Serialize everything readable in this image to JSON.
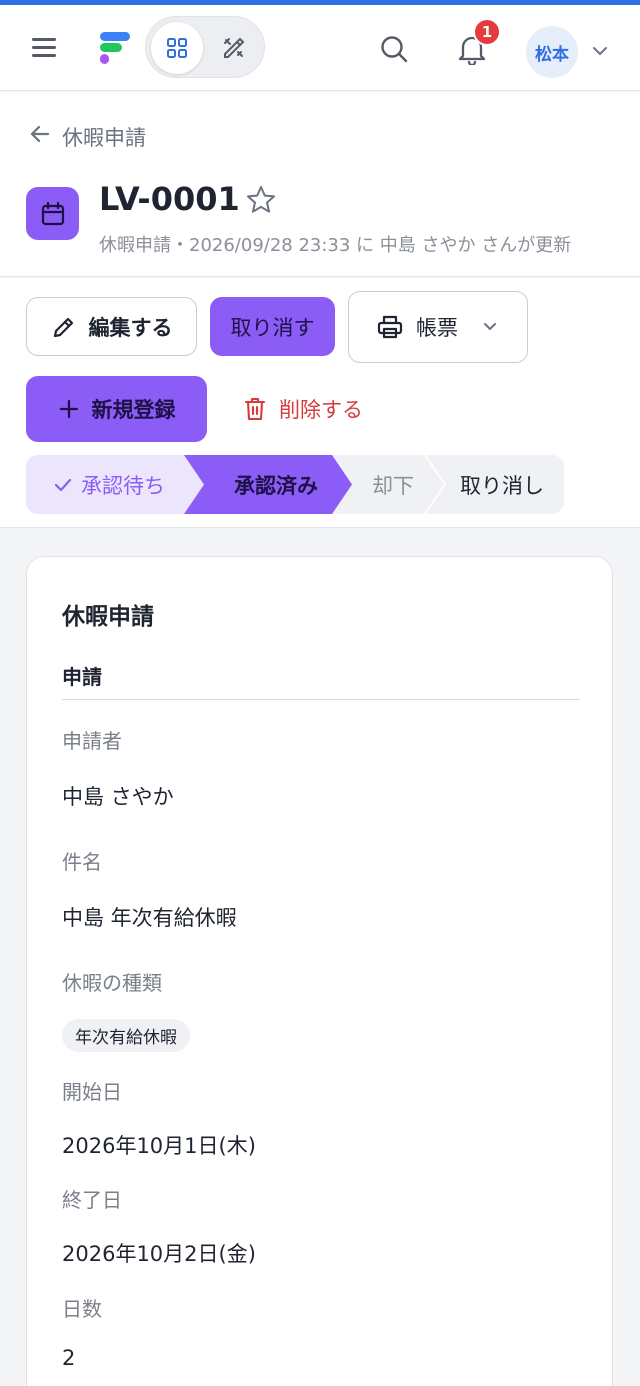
{
  "topbar": {
    "badge_count": "1",
    "user_initials": "松本",
    "icons": [
      "menu-icon",
      "app-logo",
      "grid-icon",
      "tools-icon",
      "search-icon",
      "bell-icon",
      "chevron-down-icon"
    ]
  },
  "header": {
    "breadcrumb": "休暇申請",
    "record_id": "LV-0001",
    "meta": "休暇申請・2026/09/28 23:33 に 中島 さやか さんが更新"
  },
  "actions": {
    "edit": "編集する",
    "cancel": "取り消す",
    "print": "帳票",
    "new": "新規登録",
    "delete": "削除する"
  },
  "status_steps": [
    "承認待ち",
    "承認済み",
    "却下",
    "取り消し"
  ],
  "card": {
    "title": "休暇申請",
    "section": "申請",
    "fields": [
      {
        "label": "申請者",
        "value": "中島 さやか"
      },
      {
        "label": "件名",
        "value": "中島 年次有給休暇"
      },
      {
        "label": "休暇の種類",
        "value": "年次有給休暇"
      },
      {
        "label": "開始日",
        "value": "2026年10月1日(木)"
      },
      {
        "label": "終了日",
        "value": "2026年10月2日(金)"
      },
      {
        "label": "日数",
        "value": "2"
      }
    ]
  },
  "colors": {
    "accent": "#8b5cf6",
    "accent_light": "#ece6fd",
    "brand_blue": "#2f6fe4",
    "danger": "#d83b3b",
    "badge": "#e43c3c"
  }
}
